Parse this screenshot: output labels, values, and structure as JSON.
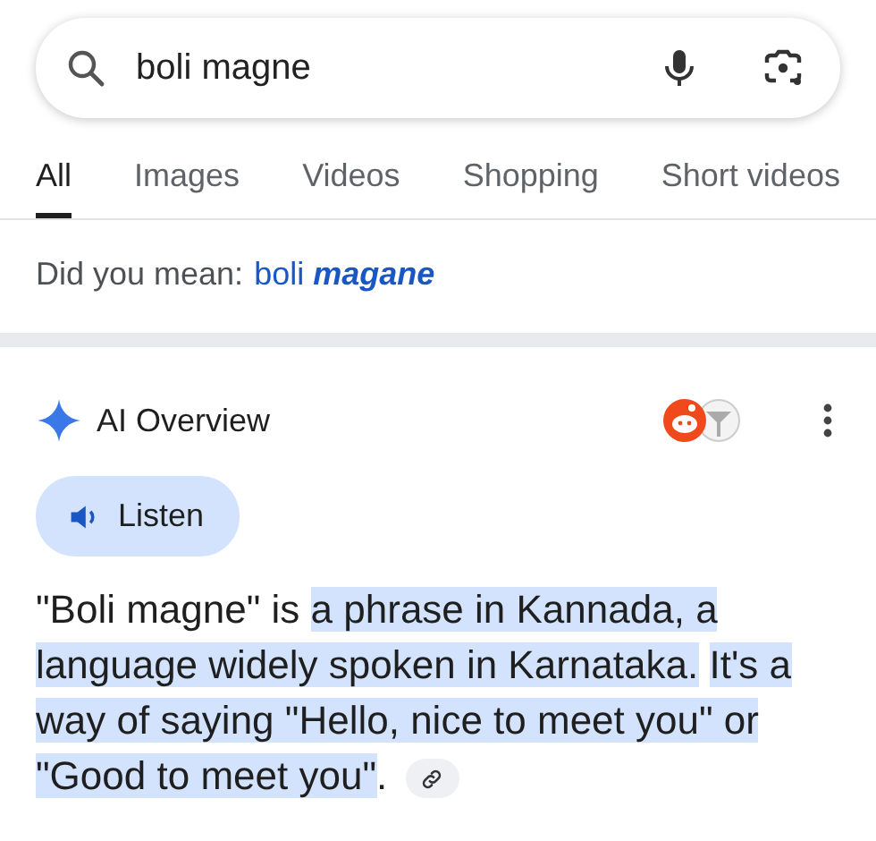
{
  "search": {
    "value": "boli magne"
  },
  "tabs": [
    {
      "label": "All",
      "selected": true
    },
    {
      "label": "Images",
      "selected": false
    },
    {
      "label": "Videos",
      "selected": false
    },
    {
      "label": "Shopping",
      "selected": false
    },
    {
      "label": "Short videos",
      "selected": false
    }
  ],
  "spelling": {
    "label": "Did you mean:",
    "words": [
      {
        "text": "boli",
        "corrected": false
      },
      {
        "text": "magane",
        "corrected": true
      }
    ]
  },
  "ai_overview": {
    "title": "AI Overview",
    "listen": "Listen",
    "segments": [
      {
        "text": "\"Boli magne\" is ",
        "highlighted": false
      },
      {
        "text": "a phrase in Kannada, a language widely spoken in Karnataka.",
        "highlighted": true
      },
      {
        "text": "It's a way of saying \"Hello, nice to meet you\" or \"Good to meet you\"",
        "highlighted": true
      },
      {
        "text": ".",
        "highlighted": false
      }
    ]
  }
}
